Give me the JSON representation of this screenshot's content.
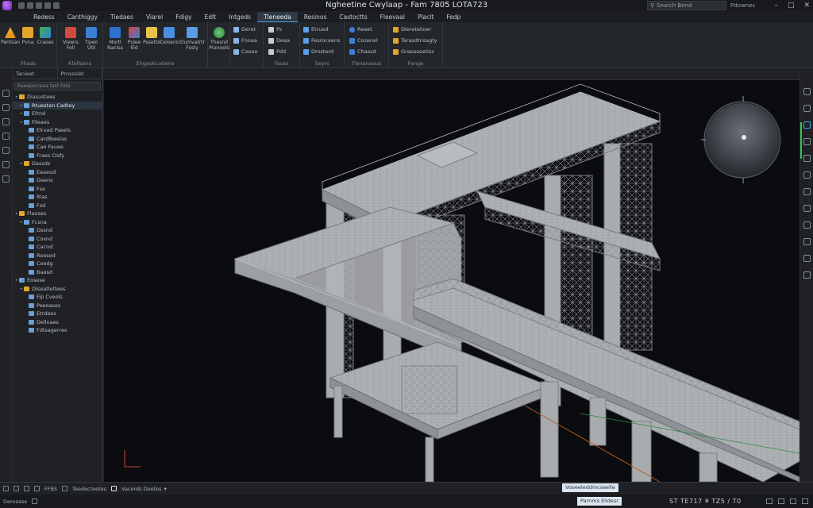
{
  "window": {
    "title": "Ngheetine Cwylaap - Fam 7805 LOTA723",
    "search_placeholder": "Search Bend",
    "user_label": "Pdownes",
    "controls": [
      "–",
      "□",
      "✕"
    ]
  },
  "menu": {
    "tabs": [
      {
        "label": "Redess"
      },
      {
        "label": "Canthiggy"
      },
      {
        "label": "Tiedaes"
      },
      {
        "label": "Viarel"
      },
      {
        "label": "Fdigy"
      },
      {
        "label": "Edlt"
      },
      {
        "label": "Intgeds"
      },
      {
        "label": "Tleneeda",
        "active": true
      },
      {
        "label": "Resinos"
      },
      {
        "label": "Castoctts"
      },
      {
        "label": "Fleevaal"
      },
      {
        "label": "Placlt"
      },
      {
        "label": "Fedp"
      }
    ]
  },
  "ribbon": {
    "groups": [
      {
        "label": "Fliads",
        "buttons": [
          "Pentsan",
          "Pvna",
          "Craoes"
        ]
      },
      {
        "label": "Kfallsens",
        "buttons": [
          "Viewrs Fell",
          "Tipeo Util"
        ]
      },
      {
        "label": "Elrgeokcatiene",
        "buttons": [
          "Mortl Nacisa",
          "Pulee Eld",
          "Pssetto",
          "Celoens",
          "Elumvatrtr Fssty"
        ]
      },
      {
        "label": "",
        "buttons": [
          "Thesnd Pranoels"
        ]
      },
      {
        "label": "",
        "items": [
          "Deret",
          "Fnoaa",
          "Coeae"
        ]
      },
      {
        "label": "Faces",
        "items": [
          "Ps",
          "Deaa",
          "Pdd"
        ]
      },
      {
        "label": "Seyrs",
        "items": [
          "Etrued",
          "Fesrocaens",
          "Dmsterd"
        ]
      },
      {
        "label": "Tlenanaous",
        "items": [
          "Reaet",
          "Cozenel",
          "Chassd"
        ]
      },
      {
        "label": "Fenge",
        "items": [
          "Dleretelioer",
          "Tarasdtnsagty",
          "Grseaasetiss"
        ]
      }
    ]
  },
  "panel": {
    "tabs": [
      "Tanieet",
      "Prnssslet"
    ],
    "search_placeholder": "Raeepscreaa tast Fate",
    "tree": [
      {
        "label": "Diasustees",
        "indent": 0,
        "icon": "folder"
      },
      {
        "label": "Rtuestan Cadtey",
        "indent": 1,
        "selected": true
      },
      {
        "label": "Efrnd",
        "indent": 1
      },
      {
        "label": "Fileaes",
        "indent": 1
      },
      {
        "label": "Elrvad Pseels",
        "indent": 2
      },
      {
        "label": "Cardlbeelas",
        "indent": 2
      },
      {
        "label": "Cae Fauee",
        "indent": 2
      },
      {
        "label": "Fraes Clsfy",
        "indent": 2
      },
      {
        "label": "Dassds",
        "indent": 1,
        "icon": "folder"
      },
      {
        "label": "Eeaeod",
        "indent": 2
      },
      {
        "label": "Daens",
        "indent": 2
      },
      {
        "label": "Fse",
        "indent": 2
      },
      {
        "label": "Rlas",
        "indent": 2
      },
      {
        "label": "Fsd",
        "indent": 2
      },
      {
        "label": "Fleoses",
        "indent": 0,
        "icon": "folder"
      },
      {
        "label": "Fcsna",
        "indent": 1
      },
      {
        "label": "Dssnd",
        "indent": 2
      },
      {
        "label": "Cosnd",
        "indent": 2
      },
      {
        "label": "Cacnd",
        "indent": 2
      },
      {
        "label": "Reesed",
        "indent": 2
      },
      {
        "label": "Coedg",
        "indent": 2
      },
      {
        "label": "Baesd",
        "indent": 2
      },
      {
        "label": "Eosese",
        "indent": 0
      },
      {
        "label": "Dlseatleltees",
        "indent": 1,
        "icon": "folder"
      },
      {
        "label": "Fip Cveols",
        "indent": 2
      },
      {
        "label": "Peeoases",
        "indent": 2
      },
      {
        "label": "Etrdees",
        "indent": 2
      },
      {
        "label": "Delloaes",
        "indent": 2
      },
      {
        "label": "Fdtsagerres",
        "indent": 2
      }
    ]
  },
  "status": {
    "items": [
      "FFBS",
      "Teedecteetes",
      "Vacerds Deetes"
    ],
    "tip": "Vooeeleddmcseelle",
    "left_label": "Deroasse"
  },
  "bottom": {
    "coord_tip": "Parnms Elidesr",
    "coords": "ST TE717 ¥ TZ5 / T0"
  },
  "colors": {
    "accent_green": "#2dc653",
    "active_tab": "#2e3a46",
    "viewport_bg": "#0b0c10"
  }
}
